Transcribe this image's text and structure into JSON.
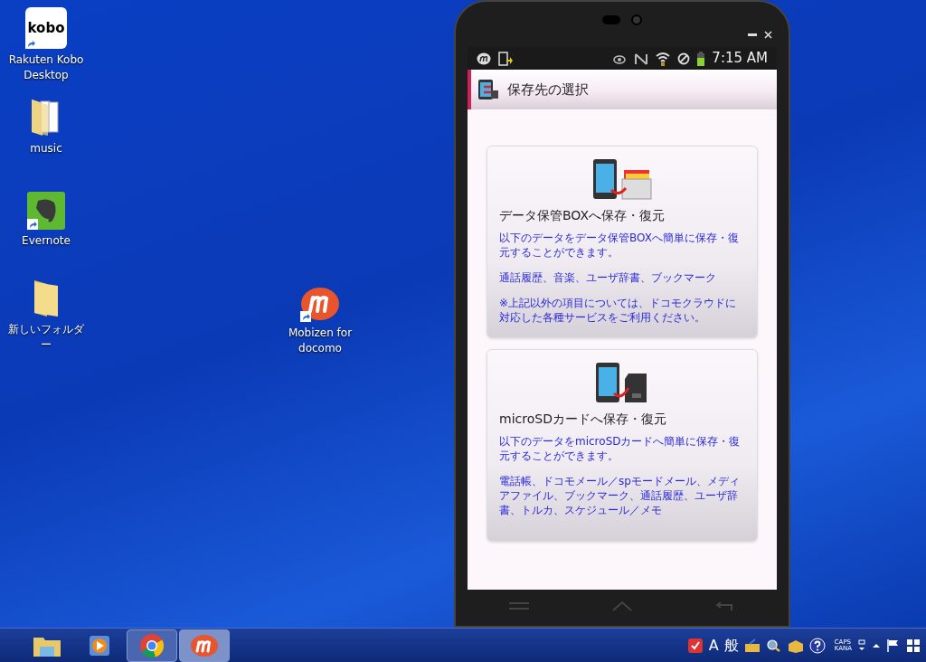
{
  "desktop_icons": [
    {
      "kind": "kobo",
      "label": "Rakuten Kobo Desktop",
      "logo": "kobo",
      "shortcut": true
    },
    {
      "kind": "folder-docs",
      "label": "music",
      "shortcut": false
    },
    {
      "kind": "evernote",
      "label": "Evernote",
      "shortcut": true
    },
    {
      "kind": "folder",
      "label": "新しいフォルダー",
      "shortcut": false
    },
    {
      "kind": "mobizen",
      "label": "Mobizen for docomo",
      "shortcut": true
    }
  ],
  "phone": {
    "status_bar": {
      "time": "7:15 AM"
    },
    "header": {
      "title": "保存先の選択"
    },
    "cards": [
      {
        "kind": "box",
        "title": "データ保管BOXへ保存・復元",
        "paragraphs": [
          "以下のデータをデータ保管BOXへ簡単に保存・復元することができます。",
          "通話履歴、音楽、ユーザ辞書、ブックマーク",
          "※上記以外の項目については、ドコモクラウドに対応した各種サービスをご利用ください。"
        ]
      },
      {
        "kind": "sd",
        "title": "microSDカードへ保存・復元",
        "paragraphs": [
          "以下のデータをmicroSDカードへ簡単に保存・復元することができます。",
          "電話帳、ドコモメール／spモードメール、メディアファイル、ブックマーク、通話履歴、ユーザ辞書、トルカ、スケジュール／メモ"
        ]
      }
    ]
  },
  "taskbar": {
    "apps": [
      {
        "kind": "explorer",
        "open": false,
        "selected": false
      },
      {
        "kind": "media",
        "open": false,
        "selected": false
      },
      {
        "kind": "chrome",
        "open": true,
        "selected": false
      },
      {
        "kind": "mobizen",
        "open": true,
        "selected": true
      }
    ],
    "ime": {
      "mode": "A",
      "dictionary": "般"
    },
    "keys": [
      "CAPS",
      "KANA"
    ]
  }
}
